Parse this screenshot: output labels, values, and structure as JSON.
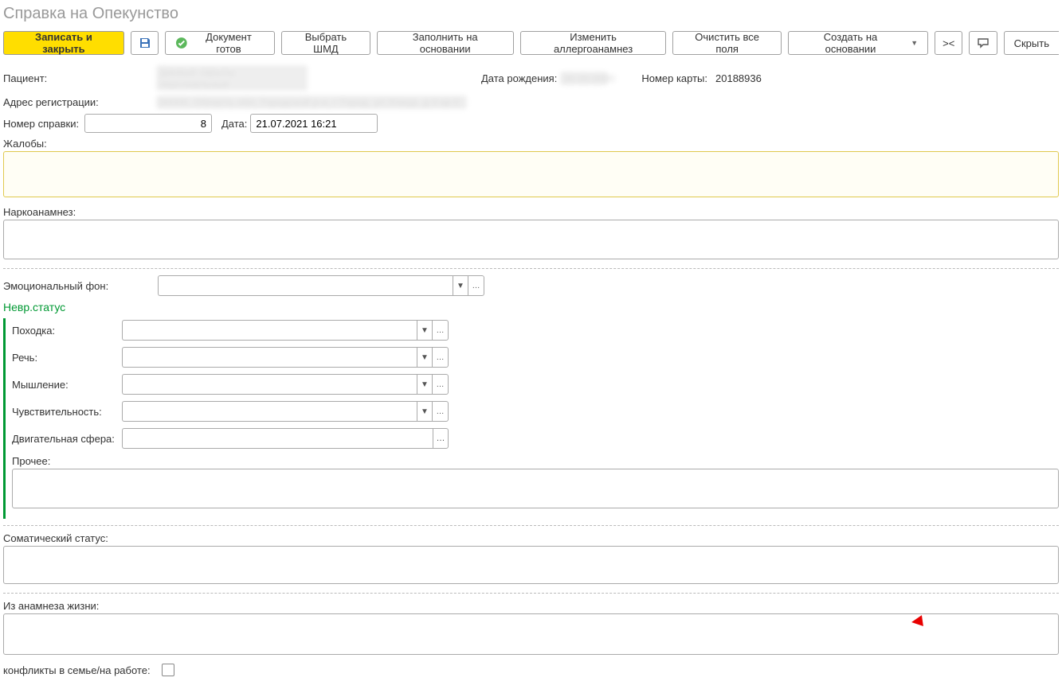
{
  "title": "Справка на Опекунство",
  "toolbar": {
    "save_close": "Записать и закрыть",
    "doc_ready": "Документ готов",
    "choose_shmd": "Выбрать ШМД",
    "fill_based": "Заполнить на основании",
    "change_allergo": "Изменить аллергоанамнез",
    "clear_all": "Очистить все поля",
    "create_based": "Создать на основании",
    "angle": "><",
    "hide": "Скрыть"
  },
  "patient": {
    "label": "Пациент:",
    "value_blur": "Данные скрыты персональные",
    "dob_label": "Дата рождения:",
    "dob_blur": "00.00.0000",
    "card_label": "Номер карты:",
    "card_value": "20188936",
    "addr_label": "Адрес регистрации:",
    "addr_blur": "00000, Область обл, Городской р-н, г Город, ул Улица, д 0 кв 0"
  },
  "cert": {
    "num_label": "Номер справки:",
    "num_value": "8",
    "date_label": "Дата:",
    "date_value": "21.07.2021 16:21"
  },
  "fields": {
    "complaints": "Жалобы:",
    "narco": "Наркоанамнез:",
    "emotional": "Эмоциональный фон:",
    "neuro_title": "Невр.статус",
    "gait": "Походка:",
    "speech": "Речь:",
    "thinking": "Мышление:",
    "sensitivity": "Чувствительность:",
    "motor": "Двигательная сфера:",
    "other": "Прочее:",
    "somatic": "Соматический статус:",
    "life_anamnesis": "Из анамнеза жизни:",
    "conflicts": "конфликты в семье/на работе:"
  }
}
